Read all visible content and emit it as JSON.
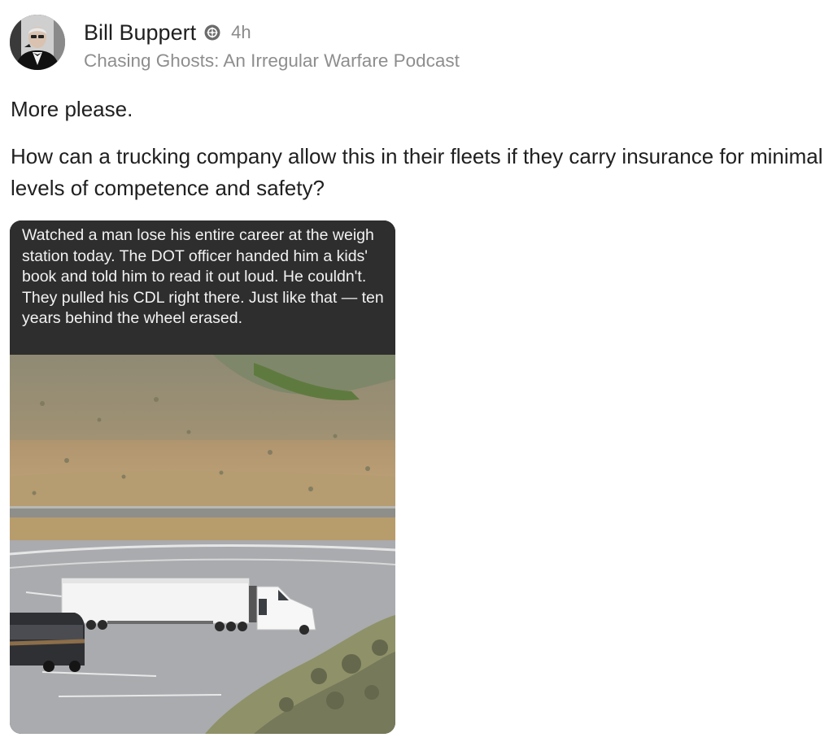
{
  "post": {
    "author": {
      "name": "Bill Buppert",
      "badge_icon": "badge-icon",
      "time": "4h",
      "community": "Chasing Ghosts: An Irregular Warfare Podcast"
    },
    "body": {
      "paragraphs": [
        "More please.",
        "How can a trucking company allow this in their fleets if they carry insurance for minimal levels of competence and safety?"
      ]
    },
    "media": {
      "caption": "Watched a man lose his entire career at the weigh station today. The DOT officer handed him a kids' book and told him to read it out loud. He couldn't. They pulled his CDL right there. Just like that — ten years behind the wheel erased."
    }
  }
}
